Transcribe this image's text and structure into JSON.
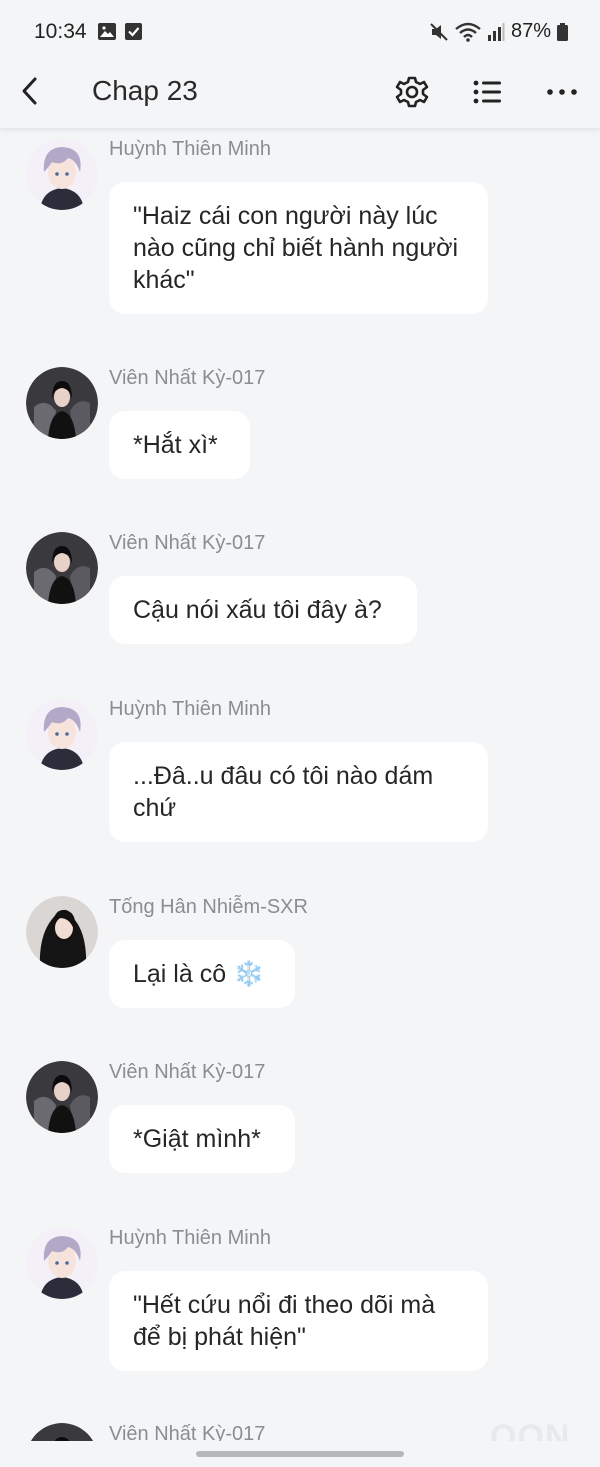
{
  "status_bar": {
    "time": "10:34",
    "battery": "87%"
  },
  "toolbar": {
    "title": "Chap 23"
  },
  "watermark": "OON",
  "messages": [
    {
      "name": "Huỳnh Thiên Minh",
      "avatar": "lavender-hair-boy",
      "text": "\"Haiz cái con người này lúc nào cũng chỉ biết hành người khác\""
    },
    {
      "name": "Viên Nhất Kỳ-017",
      "avatar": "dark-hair-girl",
      "text": "*Hắt xì*"
    },
    {
      "name": "Viên Nhất Kỳ-017",
      "avatar": "dark-hair-girl",
      "text": "Cậu nói xấu tôi đây à?"
    },
    {
      "name": "Huỳnh Thiên Minh",
      "avatar": "lavender-hair-boy",
      "text": "...Đâ..u đâu có tôi nào dám chứ"
    },
    {
      "name": "Tống Hân Nhiễm-SXR",
      "avatar": "long-hair-girl",
      "text": "Lại là cô ❄️"
    },
    {
      "name": "Viên Nhất Kỳ-017",
      "avatar": "dark-hair-girl",
      "text": "*Giật mình*"
    },
    {
      "name": "Huỳnh Thiên Minh",
      "avatar": "lavender-hair-boy",
      "text": "\"Hết cứu nổi đi theo dõi mà để bị phát hiện\""
    },
    {
      "name": "Viên Nhất Kỳ-017",
      "avatar": "dark-hair-girl",
      "text": ""
    }
  ]
}
